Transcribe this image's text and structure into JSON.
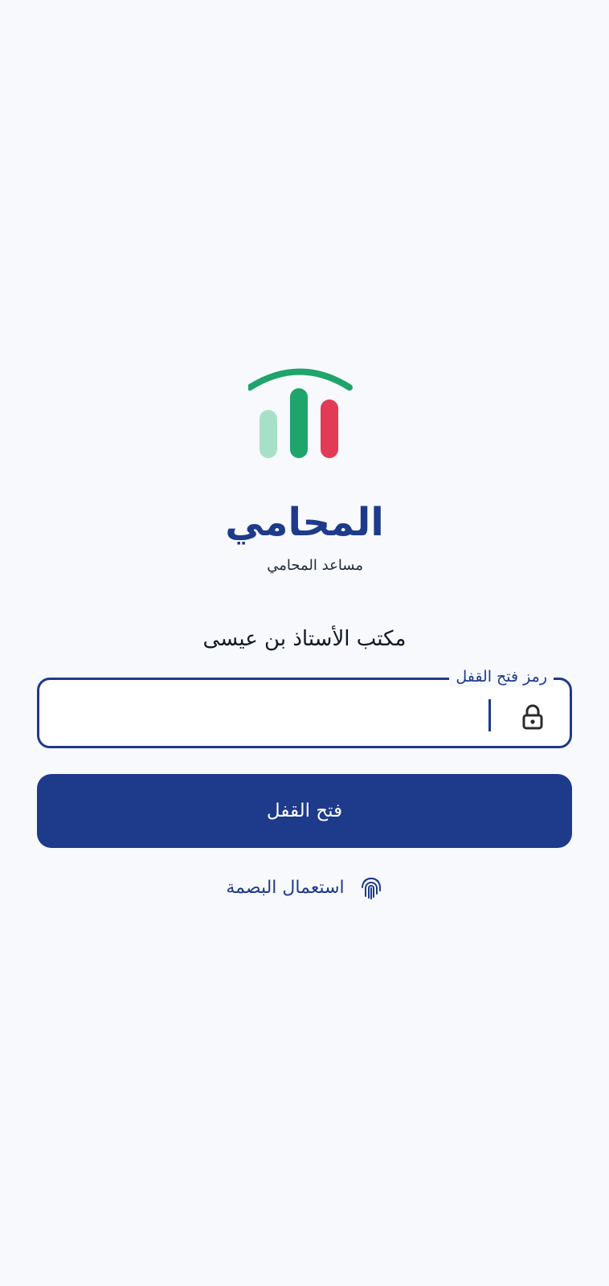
{
  "brand": {
    "title": "المحامي",
    "subtitle": "مساعد المحامي",
    "colors": {
      "primary": "#1e3a8a",
      "green": "#1fa46b",
      "light_green": "#a7e0c8",
      "red": "#e23b56",
      "background": "#f7f9fc"
    }
  },
  "office": {
    "name": "مكتب الأستاذ بن عيسى"
  },
  "unlock_field": {
    "label": "رمز فتح القفل",
    "value": "",
    "icon": "lock-icon"
  },
  "actions": {
    "unlock_label": "فتح القفل",
    "fingerprint_label": "استعمال البصمة",
    "fingerprint_icon": "fingerprint-icon"
  }
}
